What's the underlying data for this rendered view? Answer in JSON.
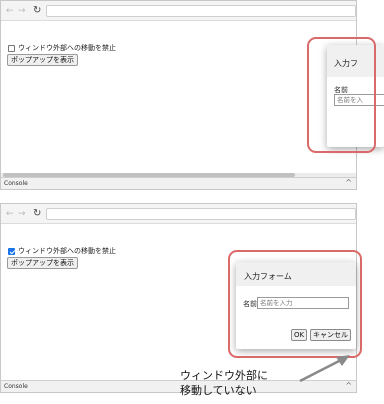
{
  "panels": [
    {
      "checkbox_label": "ウィンドウ外部への移動を禁止",
      "checkbox_checked": false,
      "show_button": "ポップアップを表示",
      "console_label": "Console",
      "dialog": {
        "title": "入力フ",
        "name_label": "名前",
        "input_placeholder": "名前を入"
      }
    },
    {
      "checkbox_label": "ウィンドウ外部への移動を禁止",
      "checkbox_checked": true,
      "show_button": "ポップアップを表示",
      "console_label": "Console",
      "dialog": {
        "title": "入力フォーム",
        "name_label": "名前",
        "input_placeholder": "名前を入力",
        "ok_label": "OK",
        "cancel_label": "キャンセル"
      }
    }
  ],
  "annotation": {
    "line1": "ウィンドウ外部に",
    "line2": "移動していない"
  },
  "icons": {
    "back": "arrow-left-icon",
    "forward": "arrow-right-icon",
    "reload": "reload-icon",
    "console_toggle": "chevron-up-icon"
  },
  "colors": {
    "highlight": "#d96a6a",
    "checkbox_on": "#1a73e8",
    "annotation_arrow": "#8a8a8a"
  }
}
